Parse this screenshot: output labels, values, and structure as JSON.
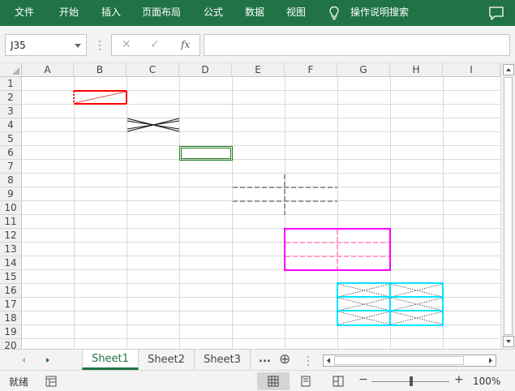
{
  "ribbon": {
    "tabs": [
      "文件",
      "开始",
      "插入",
      "页面布局",
      "公式",
      "数据",
      "视图"
    ],
    "tell_me": "操作说明搜索"
  },
  "formula_bar": {
    "name_box": "J35",
    "cancel_icon": "✕",
    "enter_icon": "✓",
    "fx_label": "fx",
    "formula": ""
  },
  "grid": {
    "columns": [
      "A",
      "B",
      "C",
      "D",
      "E",
      "F",
      "G",
      "H",
      "I"
    ],
    "rows": [
      "1",
      "2",
      "3",
      "4",
      "5",
      "6",
      "7",
      "8",
      "9",
      "10",
      "11",
      "12",
      "13",
      "14",
      "15",
      "16",
      "17",
      "18",
      "19",
      "20"
    ]
  },
  "sheets": {
    "tabs": [
      "Sheet1",
      "Sheet2",
      "Sheet3"
    ],
    "active": "Sheet1",
    "more": "...",
    "add_icon": "⊕"
  },
  "status": {
    "ready": "就绪",
    "zoom": "100%",
    "zoom_minus": "−",
    "zoom_plus": "+"
  },
  "colors": {
    "ribbon": "#217346",
    "red_border": "#ff0000",
    "green_border": "#1e7b1e",
    "gray_dash": "#999999",
    "magenta": "#ff00ff",
    "pink_dash": "#ff9bd0",
    "cyan": "#00e5ff"
  }
}
